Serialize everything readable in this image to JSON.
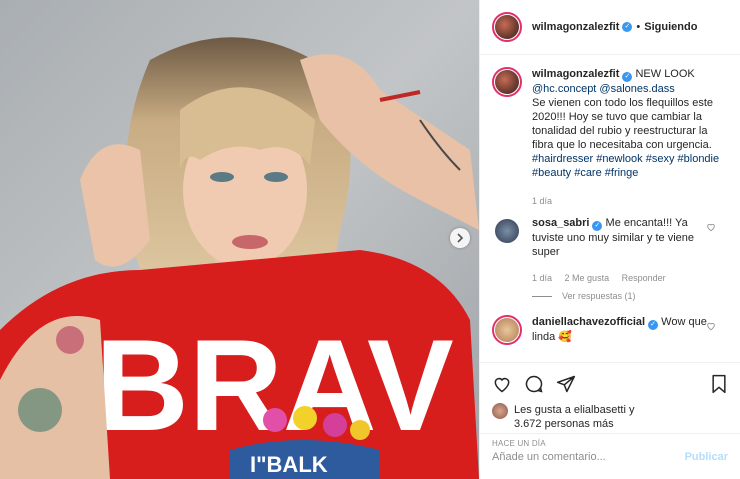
{
  "header": {
    "username": "wilmagonzalezfit",
    "separator": "•",
    "follow_status": "Siguiendo"
  },
  "caption": {
    "username": "wilmagonzalezfit",
    "title": "NEW LOOK",
    "mentions": "@hc.concept @salones.dass",
    "text": "Se vienen con todo los flequillos este 2020!!! Hoy se tuvo que cambiar la tonalidad del rubio y reestructurar la fibra que lo necesitaba con urgencia.",
    "hashtags": "#hairdresser #newlook #sexy #blondie #beauty #care #fringe",
    "time": "1 día"
  },
  "comments": [
    {
      "username": "sosa_sabri",
      "text": "Me encanta!!! Ya tuviste uno muy similar y te viene super",
      "time": "1 día",
      "likes": "2 Me gusta",
      "reply": "Responder",
      "view_replies": "Ver respuestas (1)"
    },
    {
      "username": "daniellachavezofficial",
      "text": "Wow que linda 🥰"
    }
  ],
  "likes": {
    "line1": "Les gusta a elialbasetti y",
    "line2": "3.672 personas más"
  },
  "time_ago": "HACE UN DÍA",
  "add_comment": {
    "placeholder": "Añade un comentario...",
    "publish_label": "Publicar"
  },
  "photo": {
    "shirt_text": "BRAV",
    "shirt_bottom": "I\"BALK",
    "shirt_color": "#d81d1d"
  },
  "icons": {
    "verified": "verified-badge-icon",
    "heart": "heart-icon",
    "comment": "comment-icon",
    "share": "share-icon",
    "save": "bookmark-icon",
    "next": "chevron-right-icon"
  }
}
